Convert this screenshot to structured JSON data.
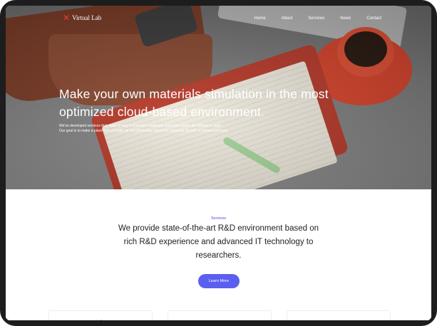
{
  "header": {
    "logo_text": "Virtual Lab",
    "logo_icon": "star-logo-icon",
    "nav": [
      {
        "label": "Home"
      },
      {
        "label": "About"
      },
      {
        "label": "Services"
      },
      {
        "label": "News"
      },
      {
        "label": "Contact"
      }
    ]
  },
  "hero": {
    "title_line1": "Make your own materials simulation in the most",
    "title_line2": "optimized cloud-based environment.",
    "subtitle_line1": "We've developed services that make it easy to introduce materials simulation which are difficult to start.",
    "subtitle_line2": "Our goal is to make a place that provides all the information about the materials as well as various services."
  },
  "services": {
    "label": "Services",
    "title_line1": "We provide state-of-the-art R&D environment based on",
    "title_line2": "rich R&D experience and advanced IT technology to",
    "title_line3": "researchers.",
    "button_label": "Learn More",
    "cards": [
      {
        "icon": "atom-icon"
      },
      {
        "icon": "graduation-cap-icon"
      },
      {
        "icon": "chart-icon"
      }
    ]
  },
  "colors": {
    "accent": "#5b5ff0",
    "logo_red": "#e53a3a"
  }
}
